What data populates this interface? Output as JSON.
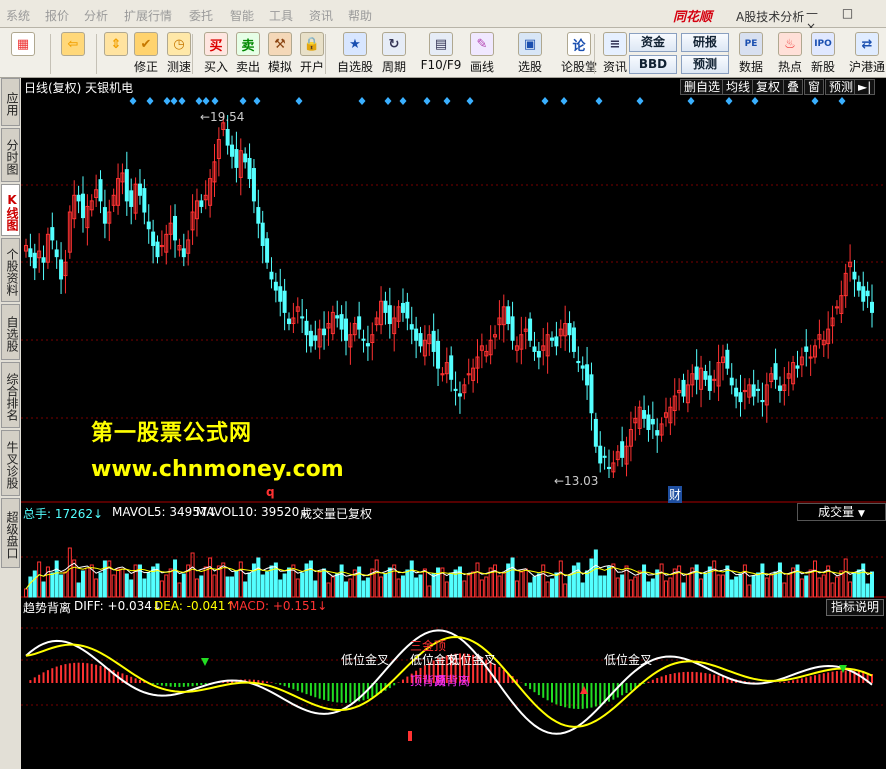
{
  "menu": [
    "系统",
    "报价",
    "分析",
    "扩展行情",
    "委托",
    "智能",
    "工具",
    "资讯",
    "帮助"
  ],
  "brand": {
    "logo": "同花顺",
    "sub": "A股技术分析",
    "window_controls": "— □ ×"
  },
  "toolbar": {
    "buttons": [
      {
        "label": "",
        "icon": "windows-icon"
      },
      {
        "label": "",
        "icon": "back-arrow-icon"
      },
      {
        "label": "",
        "icon": "up-down-arrows-icon"
      },
      {
        "label": "修正",
        "icon": "fix-icon"
      },
      {
        "label": "测速",
        "icon": "clock-icon"
      },
      {
        "label": "买入",
        "icon": "buy-icon",
        "glyph": "买"
      },
      {
        "label": "卖出",
        "icon": "sell-icon",
        "glyph": "卖"
      },
      {
        "label": "模拟",
        "icon": "hammer-icon"
      },
      {
        "label": "开户",
        "icon": "lock-icon"
      },
      {
        "label": "自选股",
        "icon": "star-icon"
      },
      {
        "label": "周期",
        "icon": "cycle-icon"
      },
      {
        "label": "F10/F9",
        "icon": "f10-icon"
      },
      {
        "label": "画线",
        "icon": "pencil-icon"
      },
      {
        "label": "选股",
        "icon": "select-stock-icon"
      },
      {
        "label": "论股堂",
        "icon": "forum-icon",
        "glyph": "论"
      },
      {
        "label": "资讯",
        "icon": "news-icon"
      },
      {
        "label": "数据",
        "icon": "pe-icon",
        "glyph": "PE"
      },
      {
        "label": "热点",
        "icon": "hot-icon"
      },
      {
        "label": "新股",
        "icon": "ipo-icon",
        "glyph": "IPO"
      },
      {
        "label": "沪港通",
        "icon": "hk-connect-icon"
      }
    ],
    "small_buttons": [
      "资金",
      "研报",
      "BBD",
      "预测"
    ]
  },
  "sidebar": [
    "应用",
    "分时图",
    "K线图",
    "个股资料",
    "自选股",
    "综合排名",
    "牛叉诊股",
    "超级盘口"
  ],
  "sidebar_active": 2,
  "chart_header": {
    "title": "日线(复权) 天银机电",
    "buttons": [
      "删自选",
      "均线",
      "复权",
      "叠",
      "窗",
      "预测"
    ],
    "nav_icon": "►|"
  },
  "price_labels": {
    "high": "←19.54",
    "low": "←13.03"
  },
  "markers": {
    "q": "q",
    "cai": "财"
  },
  "watermark": {
    "line1": "第一股票公式网",
    "line2": "www.chnmoney.com"
  },
  "volume_header": {
    "total": "总手: 17262↓",
    "ma5": "MAVOL5: 34957↓",
    "ma10": "MAVOL10: 39520↓",
    "note": "成交量已复权",
    "selector": "成交量"
  },
  "macd_header": {
    "name": "趋势背离",
    "diff": "DIFF: +0.034↓",
    "dea": "DEA: -0.041↑",
    "macd": "MACD: +0.151↓",
    "explain": "指标说明"
  },
  "macd_labels": {
    "low_cross": "低位金叉",
    "three_gold": "三金顶",
    "top_divergence": "顶背离"
  },
  "colors": {
    "up": "#ff3232",
    "down": "#54ffff",
    "ma5": "#ffffff",
    "ma10": "#ffff00",
    "diff": "#ffffff",
    "dea": "#ffff00",
    "grid": "#7a0000",
    "title_blue": "#54ffff"
  },
  "chart_data": {
    "type": "candlestick",
    "price_range": [
      13.03,
      19.54
    ],
    "closes": [
      17.2,
      17.0,
      16.8,
      17.1,
      16.9,
      17.4,
      17.3,
      17.0,
      16.6,
      16.9,
      17.8,
      18.1,
      18.0,
      17.7,
      17.9,
      18.0,
      18.2,
      18.0,
      17.6,
      17.8,
      18.1,
      18.4,
      18.5,
      18.0,
      17.9,
      18.3,
      18.1,
      17.8,
      17.5,
      17.2,
      17.0,
      17.2,
      17.4,
      17.6,
      17.3,
      17.2,
      17.0,
      17.3,
      17.8,
      18.0,
      17.9,
      18.1,
      18.4,
      18.7,
      19.1,
      19.4,
      19.0,
      18.8,
      18.6,
      18.9,
      18.7,
      18.4,
      18.0,
      17.6,
      17.2,
      16.9,
      16.6,
      16.4,
      16.2,
      16.0,
      15.8,
      15.9,
      16.1,
      15.9,
      15.6,
      15.4,
      15.5,
      15.7,
      15.6,
      15.8,
      16.0,
      15.9,
      15.7,
      15.5,
      15.6,
      15.8,
      15.7,
      15.5,
      15.4,
      15.6,
      15.9,
      16.2,
      16.0,
      15.8,
      15.9,
      16.1,
      16.0,
      15.9,
      15.7,
      15.5,
      15.4,
      15.5,
      15.6,
      15.3,
      15.0,
      14.9,
      15.1,
      14.8,
      14.6,
      14.5,
      14.7,
      14.9,
      15.0,
      15.2,
      15.4,
      15.3,
      15.5,
      15.6,
      15.9,
      16.1,
      15.8,
      15.5,
      15.4,
      15.6,
      15.7,
      15.5,
      15.3,
      15.2,
      15.4,
      15.6,
      15.5,
      15.4,
      15.7,
      15.8,
      15.6,
      15.3,
      15.1,
      15.0,
      14.7,
      14.2,
      13.6,
      13.3,
      13.4,
      13.2,
      13.3,
      13.5,
      13.4,
      13.6,
      13.9,
      14.1,
      14.3,
      14.1,
      13.9,
      14.0,
      13.8,
      14.0,
      14.2,
      14.3,
      14.5,
      14.6,
      14.5,
      14.7,
      14.9,
      14.8,
      15.0,
      14.8,
      14.6,
      14.8,
      15.1,
      15.2,
      15.0,
      14.7,
      14.5,
      14.4,
      14.6,
      14.7,
      14.5,
      14.6,
      14.4,
      14.7,
      14.9,
      14.8,
      14.6,
      14.7,
      14.9,
      15.1,
      15.0,
      15.2,
      15.3,
      15.2,
      15.4,
      15.6,
      15.5,
      15.7,
      15.9,
      16.1,
      16.3,
      16.7,
      16.9,
      16.6,
      16.4,
      16.2,
      16.3,
      16.0
    ]
  }
}
